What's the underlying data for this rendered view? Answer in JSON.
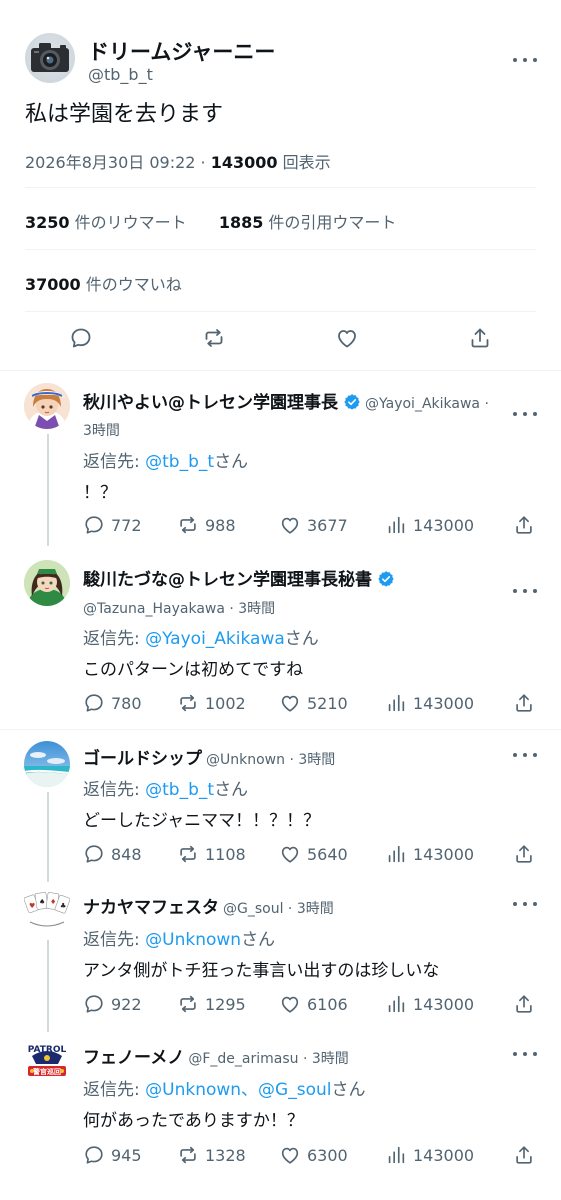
{
  "main": {
    "name": "ドリームジャーニー",
    "handle": "@tb_b_t",
    "text": "私は学園を去ります",
    "date": "2026年8月30日 09:22 · ",
    "views_count": "143000",
    "views_label": " 回表示",
    "retweets_count": "3250",
    "retweets_label": " 件のリウマート",
    "quotes_count": "1885",
    "quotes_label": " 件の引用ウマート",
    "likes_count": "37000",
    "likes_label": " 件のウマいね"
  },
  "replies": [
    {
      "name": "秋川やよい@トレセン学園理事長",
      "handle": "@Yayoi_Akikawa ·",
      "time": "3時間",
      "reply_prefix": "返信先: ",
      "reply_to": "@tb_b_t",
      "reply_suffix": "さん",
      "text": "！？",
      "counts": {
        "reply": "772",
        "retweet": "988",
        "like": "3677",
        "views": "143000"
      }
    },
    {
      "name": "駿川たづな@トレセン学園理事長秘書",
      "handle": "@Tazuna_Hayakawa · 3時間",
      "reply_prefix": "返信先: ",
      "reply_to": "@Yayoi_Akikawa",
      "reply_suffix": "さん",
      "text": "このパターンは初めてですね",
      "counts": {
        "reply": "780",
        "retweet": "1002",
        "like": "5210",
        "views": "143000"
      }
    },
    {
      "name": "ゴールドシップ",
      "handle": "@Unknown · 3時間",
      "reply_prefix": "返信先: ",
      "reply_to": "@tb_b_t",
      "reply_suffix": "さん",
      "text": "どーしたジャニママ！！？！？",
      "counts": {
        "reply": "848",
        "retweet": "1108",
        "like": "5640",
        "views": "143000"
      }
    },
    {
      "name": "ナカヤマフェスタ",
      "handle": "@G_soul · 3時間",
      "reply_prefix": "返信先: ",
      "reply_to": "@Unknown",
      "reply_suffix": "さん",
      "text": "アンタ側がトチ狂った事言い出すのは珍しいな",
      "counts": {
        "reply": "922",
        "retweet": "1295",
        "like": "6106",
        "views": "143000"
      }
    },
    {
      "name": "フェノーメノ",
      "handle": "@F_de_arimasu · 3時間",
      "reply_prefix": "返信先: ",
      "reply_to": "@Unknown、@G_soul",
      "reply_suffix": "さん",
      "text": "何があったでありますか！？",
      "patrol_top": "PATROL",
      "patrol_bottom": "警官巡回",
      "counts": {
        "reply": "945",
        "retweet": "1328",
        "like": "6300",
        "views": "143000"
      }
    }
  ],
  "icons": {
    "reply": "speech-bubble-icon",
    "retweet": "retweet-icon",
    "like": "heart-icon",
    "views": "bar-chart-icon",
    "share": "share-icon",
    "bookmark": "bookmark-icon",
    "more": "more-dots-icon",
    "verified": "verified-badge-icon"
  },
  "colors": {
    "link": "#1d9bf0",
    "muted": "#536471",
    "text": "#0f1419",
    "thread": "#cfd9de"
  }
}
